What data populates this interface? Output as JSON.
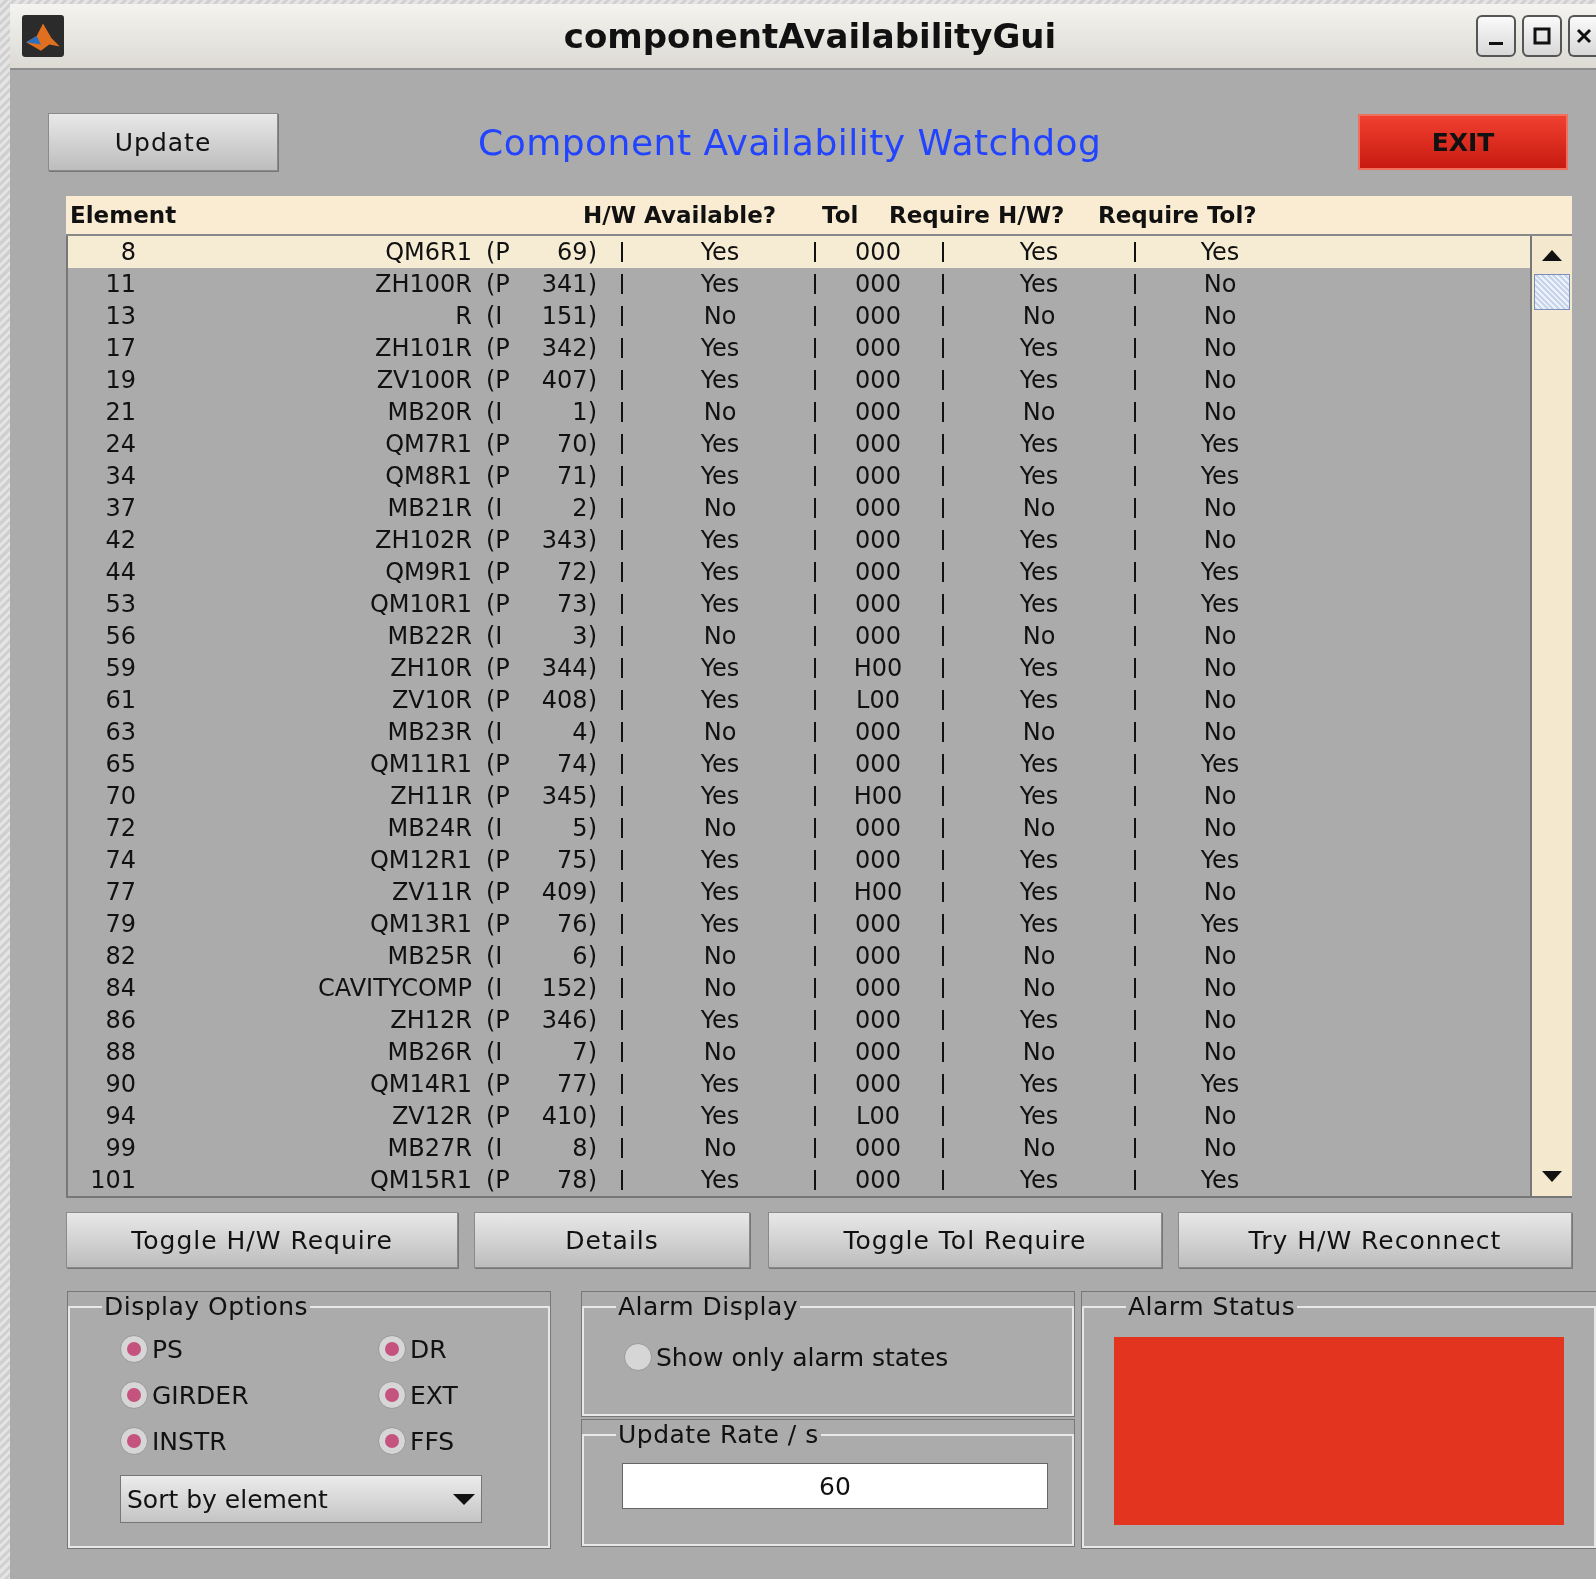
{
  "window": {
    "title": "componentAvailabilityGui"
  },
  "toolbar": {
    "update_button": "Update",
    "heading": "Component Availability Watchdog",
    "exit_button": "EXIT"
  },
  "table": {
    "columns": [
      "Element",
      "H/W Available?",
      "Tol",
      "Require H/W?",
      "Require Tol?"
    ],
    "rows": [
      {
        "number": "8",
        "element": "QM6R1",
        "group": "(P",
        "id": "69)",
        "hw_available": "Yes",
        "tol": "000",
        "require_hw": "Yes",
        "require_tol": "Yes",
        "selected": true
      },
      {
        "number": "11",
        "element": "ZH100R",
        "group": "(P",
        "id": "341)",
        "hw_available": "Yes",
        "tol": "000",
        "require_hw": "Yes",
        "require_tol": "No",
        "selected": false
      },
      {
        "number": "13",
        "element": "R",
        "group": "(I",
        "id": "151)",
        "hw_available": "No",
        "tol": "000",
        "require_hw": "No",
        "require_tol": "No",
        "selected": false
      },
      {
        "number": "17",
        "element": "ZH101R",
        "group": "(P",
        "id": "342)",
        "hw_available": "Yes",
        "tol": "000",
        "require_hw": "Yes",
        "require_tol": "No",
        "selected": false
      },
      {
        "number": "19",
        "element": "ZV100R",
        "group": "(P",
        "id": "407)",
        "hw_available": "Yes",
        "tol": "000",
        "require_hw": "Yes",
        "require_tol": "No",
        "selected": false
      },
      {
        "number": "21",
        "element": "MB20R",
        "group": "(I",
        "id": "1)",
        "hw_available": "No",
        "tol": "000",
        "require_hw": "No",
        "require_tol": "No",
        "selected": false
      },
      {
        "number": "24",
        "element": "QM7R1",
        "group": "(P",
        "id": "70)",
        "hw_available": "Yes",
        "tol": "000",
        "require_hw": "Yes",
        "require_tol": "Yes",
        "selected": false
      },
      {
        "number": "34",
        "element": "QM8R1",
        "group": "(P",
        "id": "71)",
        "hw_available": "Yes",
        "tol": "000",
        "require_hw": "Yes",
        "require_tol": "Yes",
        "selected": false
      },
      {
        "number": "37",
        "element": "MB21R",
        "group": "(I",
        "id": "2)",
        "hw_available": "No",
        "tol": "000",
        "require_hw": "No",
        "require_tol": "No",
        "selected": false
      },
      {
        "number": "42",
        "element": "ZH102R",
        "group": "(P",
        "id": "343)",
        "hw_available": "Yes",
        "tol": "000",
        "require_hw": "Yes",
        "require_tol": "No",
        "selected": false
      },
      {
        "number": "44",
        "element": "QM9R1",
        "group": "(P",
        "id": "72)",
        "hw_available": "Yes",
        "tol": "000",
        "require_hw": "Yes",
        "require_tol": "Yes",
        "selected": false
      },
      {
        "number": "53",
        "element": "QM10R1",
        "group": "(P",
        "id": "73)",
        "hw_available": "Yes",
        "tol": "000",
        "require_hw": "Yes",
        "require_tol": "Yes",
        "selected": false
      },
      {
        "number": "56",
        "element": "MB22R",
        "group": "(I",
        "id": "3)",
        "hw_available": "No",
        "tol": "000",
        "require_hw": "No",
        "require_tol": "No",
        "selected": false
      },
      {
        "number": "59",
        "element": "ZH10R",
        "group": "(P",
        "id": "344)",
        "hw_available": "Yes",
        "tol": "H00",
        "require_hw": "Yes",
        "require_tol": "No",
        "selected": false
      },
      {
        "number": "61",
        "element": "ZV10R",
        "group": "(P",
        "id": "408)",
        "hw_available": "Yes",
        "tol": "L00",
        "require_hw": "Yes",
        "require_tol": "No",
        "selected": false
      },
      {
        "number": "63",
        "element": "MB23R",
        "group": "(I",
        "id": "4)",
        "hw_available": "No",
        "tol": "000",
        "require_hw": "No",
        "require_tol": "No",
        "selected": false
      },
      {
        "number": "65",
        "element": "QM11R1",
        "group": "(P",
        "id": "74)",
        "hw_available": "Yes",
        "tol": "000",
        "require_hw": "Yes",
        "require_tol": "Yes",
        "selected": false
      },
      {
        "number": "70",
        "element": "ZH11R",
        "group": "(P",
        "id": "345)",
        "hw_available": "Yes",
        "tol": "H00",
        "require_hw": "Yes",
        "require_tol": "No",
        "selected": false
      },
      {
        "number": "72",
        "element": "MB24R",
        "group": "(I",
        "id": "5)",
        "hw_available": "No",
        "tol": "000",
        "require_hw": "No",
        "require_tol": "No",
        "selected": false
      },
      {
        "number": "74",
        "element": "QM12R1",
        "group": "(P",
        "id": "75)",
        "hw_available": "Yes",
        "tol": "000",
        "require_hw": "Yes",
        "require_tol": "Yes",
        "selected": false
      },
      {
        "number": "77",
        "element": "ZV11R",
        "group": "(P",
        "id": "409)",
        "hw_available": "Yes",
        "tol": "H00",
        "require_hw": "Yes",
        "require_tol": "No",
        "selected": false
      },
      {
        "number": "79",
        "element": "QM13R1",
        "group": "(P",
        "id": "76)",
        "hw_available": "Yes",
        "tol": "000",
        "require_hw": "Yes",
        "require_tol": "Yes",
        "selected": false
      },
      {
        "number": "82",
        "element": "MB25R",
        "group": "(I",
        "id": "6)",
        "hw_available": "No",
        "tol": "000",
        "require_hw": "No",
        "require_tol": "No",
        "selected": false
      },
      {
        "number": "84",
        "element": "CAVITYCOMP",
        "group": "(I",
        "id": "152)",
        "hw_available": "No",
        "tol": "000",
        "require_hw": "No",
        "require_tol": "No",
        "selected": false
      },
      {
        "number": "86",
        "element": "ZH12R",
        "group": "(P",
        "id": "346)",
        "hw_available": "Yes",
        "tol": "000",
        "require_hw": "Yes",
        "require_tol": "No",
        "selected": false
      },
      {
        "number": "88",
        "element": "MB26R",
        "group": "(I",
        "id": "7)",
        "hw_available": "No",
        "tol": "000",
        "require_hw": "No",
        "require_tol": "No",
        "selected": false
      },
      {
        "number": "90",
        "element": "QM14R1",
        "group": "(P",
        "id": "77)",
        "hw_available": "Yes",
        "tol": "000",
        "require_hw": "Yes",
        "require_tol": "Yes",
        "selected": false
      },
      {
        "number": "94",
        "element": "ZV12R",
        "group": "(P",
        "id": "410)",
        "hw_available": "Yes",
        "tol": "L00",
        "require_hw": "Yes",
        "require_tol": "No",
        "selected": false
      },
      {
        "number": "99",
        "element": "MB27R",
        "group": "(I",
        "id": "8)",
        "hw_available": "No",
        "tol": "000",
        "require_hw": "No",
        "require_tol": "No",
        "selected": false
      },
      {
        "number": "101",
        "element": "QM15R1",
        "group": "(P",
        "id": "78)",
        "hw_available": "Yes",
        "tol": "000",
        "require_hw": "Yes",
        "require_tol": "Yes",
        "selected": false
      }
    ]
  },
  "actions": [
    "Toggle H/W Require",
    "Details",
    "Toggle Tol Require",
    "Try H/W Reconnect"
  ],
  "display_options": {
    "title": "Display Options",
    "options": [
      {
        "label": "PS",
        "checked": true
      },
      {
        "label": "DR",
        "checked": true
      },
      {
        "label": "GIRDER",
        "checked": true
      },
      {
        "label": "EXT",
        "checked": true
      },
      {
        "label": "INSTR",
        "checked": true
      },
      {
        "label": "FFS",
        "checked": true
      }
    ],
    "sort": "Sort by element"
  },
  "alarm_display": {
    "title": "Alarm Display",
    "label": "Show only alarm states",
    "checked": false
  },
  "update_rate": {
    "title": "Update Rate / s",
    "value": "60"
  },
  "alarm_status": {
    "title": "Alarm Status",
    "color": "#e33420"
  }
}
